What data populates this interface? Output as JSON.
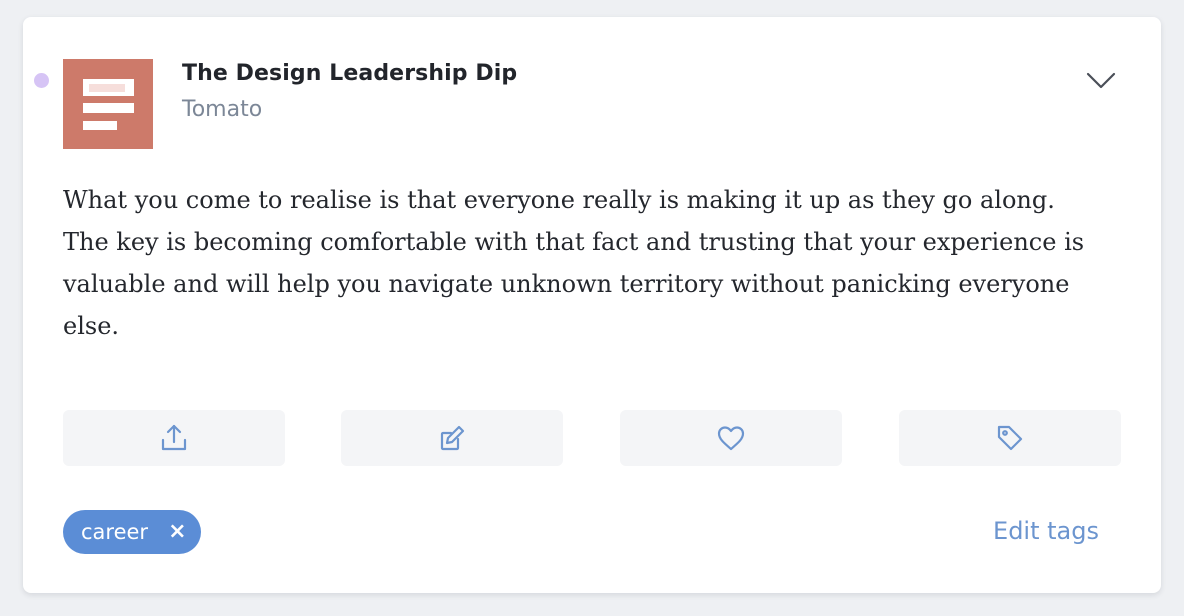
{
  "highlight": {
    "title": "The Design Leadership Dip",
    "source": "Tomato",
    "unread": true,
    "quote": "What you come to realise is that everyone really is making it up as they go along. The key is becoming comfortable with that fact and trusting that your experience is valuable and will help you navigate unknown territory without panicking everyone else.",
    "thumbnail_color": "#cd7a6a"
  },
  "actions": [
    {
      "name": "share",
      "icon": "share-upload-icon"
    },
    {
      "name": "edit",
      "icon": "edit-note-icon"
    },
    {
      "name": "favorite",
      "icon": "heart-icon"
    },
    {
      "name": "tag",
      "icon": "tag-icon"
    }
  ],
  "tags": [
    {
      "label": "career",
      "remove_glyph": "×"
    }
  ],
  "edit_tags_label": "Edit tags",
  "colors": {
    "accent": "#5b8dd6",
    "icon": "#6c95cf",
    "unread_dot": "#d6c4f5"
  }
}
